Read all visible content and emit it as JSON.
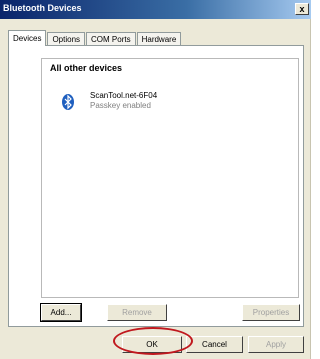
{
  "window": {
    "title": "Bluetooth Devices",
    "close_label": "x"
  },
  "tabs": [
    {
      "label": "Devices"
    },
    {
      "label": "Options"
    },
    {
      "label": "COM Ports"
    },
    {
      "label": "Hardware"
    }
  ],
  "devices": {
    "group_header": "All other devices",
    "items": [
      {
        "name": "ScanTool.net-6F04",
        "status": "Passkey enabled",
        "icon": "bluetooth-icon"
      }
    ]
  },
  "actions": {
    "add_label": "Add...",
    "remove_label": "Remove",
    "properties_label": "Properties"
  },
  "footer": {
    "ok_label": "OK",
    "cancel_label": "Cancel",
    "apply_label": "Apply"
  },
  "colors": {
    "titlebar_start": "#0a246a",
    "annotation_circle": "#c0181e",
    "bluetooth": "#1f5fbf"
  }
}
